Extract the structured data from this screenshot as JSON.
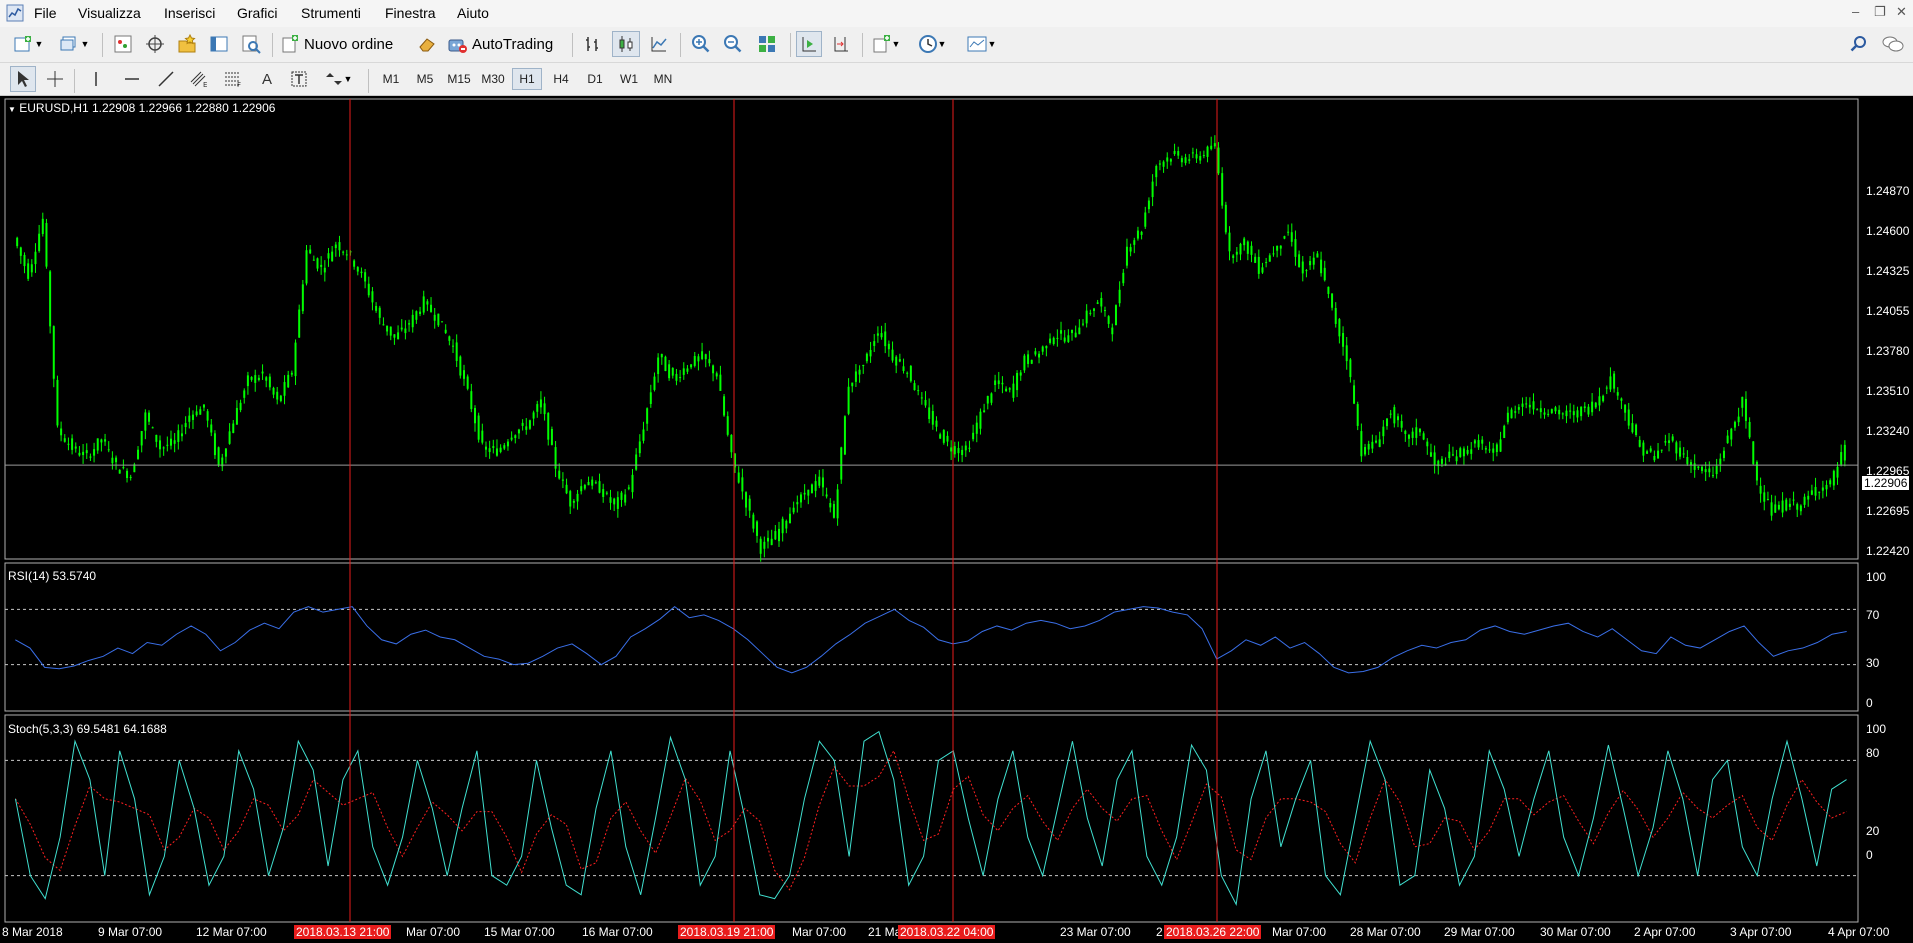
{
  "menu": {
    "items": [
      "File",
      "Visualizza",
      "Inserisci",
      "Grafici",
      "Strumenti",
      "Finestra",
      "Aiuto"
    ]
  },
  "toolbar": {
    "new_order_label": "Nuovo ordine",
    "autotrading_label": "AutoTrading",
    "timeframes": [
      "M1",
      "M5",
      "M15",
      "M30",
      "H1",
      "H4",
      "D1",
      "W1",
      "MN"
    ],
    "active_timeframe": "H1"
  },
  "chart": {
    "symbol_header": "EURUSD,H1  1.22908 1.22966 1.22880 1.22906",
    "current_price": "1.22906",
    "price_axis": [
      "1.24870",
      "1.24600",
      "1.24325",
      "1.24055",
      "1.23780",
      "1.23510",
      "1.23240",
      "1.22965",
      "1.22695",
      "1.22420"
    ],
    "rsi_header": "RSI(14) 53.5740",
    "rsi_axis": [
      "100",
      "70",
      "30",
      "0"
    ],
    "stoch_header": "Stoch(5,3,3) 69.5481 64.1688",
    "stoch_axis": [
      "100",
      "80",
      "20",
      "0"
    ],
    "time_axis": [
      "8 Mar 2018",
      "9 Mar 07:00",
      "12 Mar 07:00",
      "Mar 07:00",
      "15 Mar 07:00",
      "16 Mar 07:00",
      "Mar 07:00",
      "21 Ma",
      "23 Mar 07:00",
      "2",
      "Mar 07:00",
      "28 Mar 07:00",
      "29 Mar 07:00",
      "30 Mar 07:00",
      "2 Apr 07:00",
      "3 Apr 07:00",
      "4 Apr 07:00"
    ],
    "vline_tags": [
      "2018.03.13 21:00",
      "2018.03.19 21:00",
      "2018.03.22 04:00",
      "2018.03.26 22:00"
    ]
  },
  "colors": {
    "candle": "#00ff00",
    "background": "#000000",
    "vline": "#e81c1c",
    "rsi_line": "#3a6fe8",
    "stoch_main": "#40e0d0",
    "stoch_signal": "#ff2020"
  },
  "chart_data": {
    "type": "line",
    "series": [
      {
        "name": "EURUSD,H1",
        "values": [
          1.2415,
          1.2395,
          1.2425,
          1.231,
          1.23,
          1.2295,
          1.2305,
          1.229,
          1.2285,
          1.2318,
          1.23,
          1.2303,
          1.2318,
          1.2322,
          1.229,
          1.2315,
          1.2337,
          1.234,
          1.2325,
          1.2342,
          1.2408,
          1.2398,
          1.2412,
          1.2405,
          1.239,
          1.237,
          1.236,
          1.2368,
          1.238,
          1.237,
          1.2355,
          1.233,
          1.23,
          1.2298,
          1.2308,
          1.2312,
          1.2325,
          1.229,
          1.227,
          1.2282,
          1.2278,
          1.2268,
          1.2278,
          1.2312,
          1.235,
          1.2338,
          1.2345,
          1.235,
          1.234,
          1.2295,
          1.227,
          1.2245,
          1.2252,
          1.2265,
          1.2275,
          1.2282,
          1.2262,
          1.2335,
          1.2345,
          1.2365,
          1.235,
          1.2342,
          1.2325,
          1.231,
          1.23,
          1.2298,
          1.2318,
          1.2336,
          1.233,
          1.2348,
          1.2352,
          1.2362,
          1.236,
          1.237,
          1.238,
          1.2365,
          1.241,
          1.242,
          1.2455,
          1.246,
          1.2458,
          1.246,
          1.2465,
          1.2405,
          1.2412,
          1.2398,
          1.2408,
          1.2418,
          1.2395,
          1.2405,
          1.2375,
          1.235,
          1.2298,
          1.2303,
          1.232,
          1.2305,
          1.231,
          1.229,
          1.2295,
          1.2298,
          1.2303,
          1.2295,
          1.2318,
          1.2325,
          1.2322,
          1.232,
          1.2318,
          1.232,
          1.2325,
          1.2338,
          1.232,
          1.23,
          1.2295,
          1.2305,
          1.2295,
          1.2288,
          1.2285,
          1.2305,
          1.2325,
          1.2282,
          1.2265,
          1.227,
          1.2268,
          1.2278,
          1.228,
          1.23
        ]
      }
    ],
    "ylim": [
      1.2242,
      1.2487
    ],
    "rsi": {
      "name": "RSI(14)",
      "values": [
        48,
        42,
        28,
        27,
        29,
        33,
        36,
        42,
        38,
        46,
        44,
        52,
        58,
        52,
        40,
        46,
        55,
        60,
        56,
        68,
        72,
        68,
        70,
        72,
        58,
        48,
        45,
        52,
        55,
        50,
        48,
        42,
        36,
        34,
        30,
        31,
        36,
        42,
        45,
        38,
        30,
        36,
        50,
        56,
        63,
        72,
        64,
        66,
        62,
        56,
        48,
        38,
        28,
        24,
        28,
        36,
        45,
        52,
        60,
        65,
        70,
        62,
        57,
        48,
        45,
        47,
        54,
        58,
        55,
        60,
        62,
        60,
        56,
        58,
        62,
        68,
        70,
        72,
        71,
        68,
        66,
        56,
        34,
        40,
        48,
        44,
        50,
        42,
        46,
        38,
        28,
        24,
        25,
        28,
        35,
        40,
        44,
        42,
        46,
        48,
        55,
        58,
        54,
        52,
        55,
        58,
        60,
        54,
        50,
        56,
        48,
        40,
        38,
        50,
        44,
        42,
        48,
        54,
        58,
        46,
        36,
        40,
        42,
        46,
        52,
        54
      ]
    },
    "stochastic": {
      "name": "Stoch(5,3,3)",
      "values": [
        60,
        20,
        8,
        40,
        90,
        70,
        20,
        85,
        60,
        10,
        30,
        80,
        55,
        15,
        30,
        85,
        65,
        20,
        45,
        90,
        75,
        25,
        70,
        85,
        35,
        15,
        40,
        80,
        55,
        20,
        55,
        85,
        20,
        15,
        30,
        80,
        45,
        15,
        10,
        55,
        85,
        35,
        10,
        50,
        92,
        70,
        15,
        30,
        85,
        50,
        10,
        8,
        20,
        60,
        90,
        80,
        30,
        90,
        95,
        70,
        15,
        30,
        80,
        85,
        50,
        20,
        60,
        85,
        40,
        20,
        55,
        90,
        50,
        25,
        70,
        85,
        30,
        15,
        40,
        88,
        75,
        20,
        5,
        60,
        85,
        35,
        60,
        80,
        20,
        10,
        50,
        90,
        70,
        15,
        20,
        75,
        55,
        15,
        30,
        85,
        65,
        30,
        60,
        85,
        40,
        20,
        50,
        88,
        55,
        20,
        45,
        85,
        60,
        20,
        70,
        80,
        35,
        20,
        60,
        90,
        60,
        25,
        65,
        70
      ]
    }
  }
}
